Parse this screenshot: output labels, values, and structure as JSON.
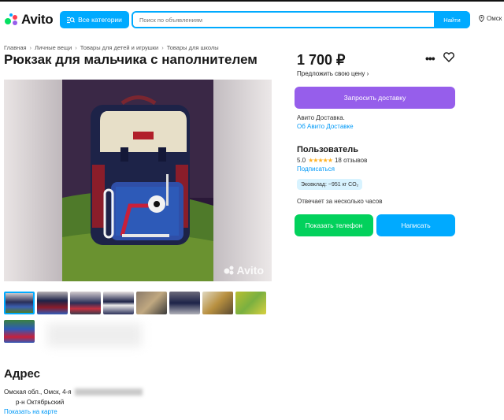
{
  "header": {
    "logo_text": "Avito",
    "categories_label": "Все категории",
    "search_placeholder": "Поиск по объявлениям",
    "search_button": "Найти",
    "location_text": "Омск"
  },
  "breadcrumbs": [
    "Главная",
    "Личные вещи",
    "Товары для детей и игрушки",
    "Товары для школы"
  ],
  "listing": {
    "title": "Рюкзак для мальчика с наполнителем",
    "price": "1 700 ₽",
    "offer_price_link": "Предложить свою цену",
    "watermark": "Avito",
    "thumbnail_count": 9
  },
  "delivery": {
    "button_label": "Запросить доставку",
    "text": "Авито Доставка.",
    "link": "Об Авито Доставке"
  },
  "seller": {
    "name": "Пользователь",
    "rating": "5.0",
    "stars": "★★★★★",
    "reviews": "18 отзывов",
    "subscribe": "Подписаться",
    "eco": "Эковклад: ~951 кг CO₂",
    "reply_time": "Отвечает за несколько часов"
  },
  "actions": {
    "phone_button": "Показать телефон",
    "write_button": "Написать"
  },
  "address": {
    "heading": "Адрес",
    "line1": "Омская обл., Омск, 4-я",
    "district": "р-н Октябрьский",
    "map_link": "Показать на карте"
  },
  "colors": {
    "brand_blue": "#00aaff",
    "delivery_purple": "#965eeb",
    "phone_green": "#02d15c",
    "link_blue": "#0099f7"
  }
}
